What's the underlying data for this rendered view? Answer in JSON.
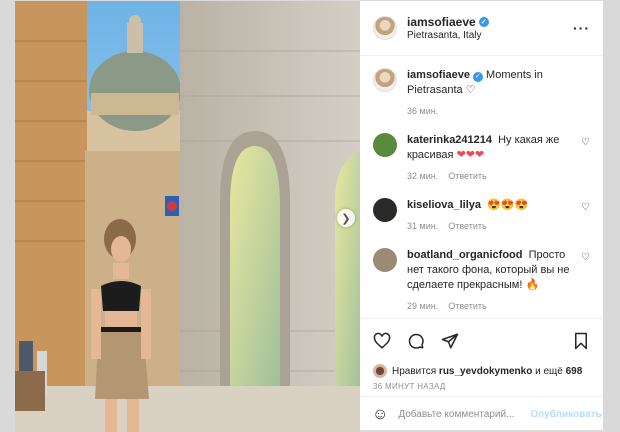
{
  "post": {
    "username": "iamsofiaeve",
    "location": "Pietrasanta, Italy",
    "more_icon": "ellipsis-icon"
  },
  "caption": {
    "username": "iamsofiaeve",
    "text": "Moments in Pietrasanta",
    "emoji": "♡",
    "time": "36 мин."
  },
  "comments": [
    {
      "username": "katerinka241214",
      "text": "Ну какая же красивая",
      "emoji": "❤❤❤",
      "time": "32 мин.",
      "reply": "Ответить",
      "avatar_color": "#5a8a3c"
    },
    {
      "username": "kiseliova_lilya",
      "text": "",
      "emoji": "😍😍😍",
      "time": "31 мин.",
      "reply": "Ответить",
      "avatar_color": "#2b2a28"
    },
    {
      "username": "boatland_organicfood",
      "text": "Просто нет такого фона, который вы не сделаете прекрасным!",
      "emoji": "🔥",
      "time": "29 мин.",
      "reply": "Ответить",
      "avatar_color": "#9a8b76"
    }
  ],
  "likes": {
    "prefix": "Нравится",
    "user": "rus_yevdokymenko",
    "suffix": "и ещё",
    "count": "698"
  },
  "ago": "36 МИНУТ НАЗАД",
  "add_comment": {
    "placeholder": "Добавьте комментарий...",
    "publish": "Опубликовать"
  },
  "colors": {
    "accent": "#3897f0",
    "like_red": "#ed4956",
    "muted": "#8e8e8e",
    "publish_disabled": "#b2dffc"
  }
}
